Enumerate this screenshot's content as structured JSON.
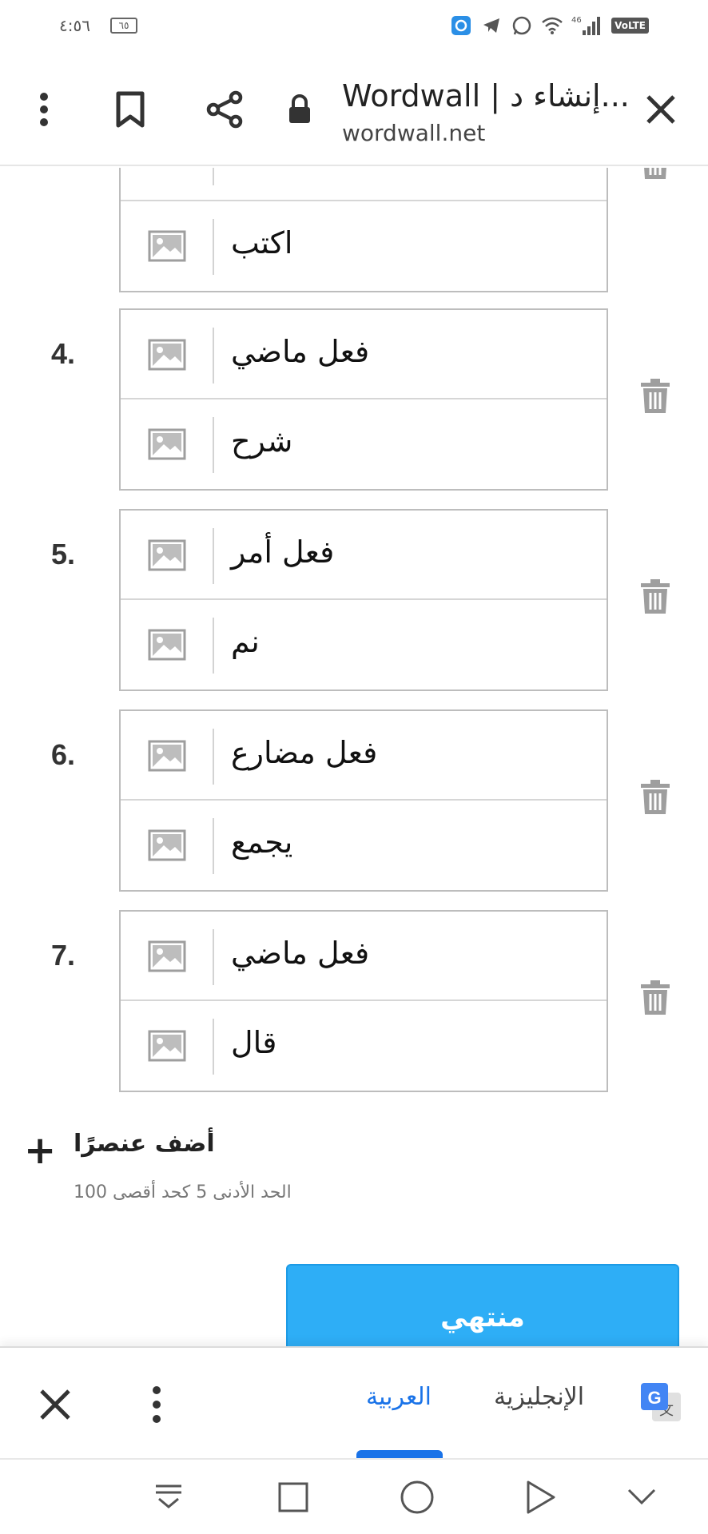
{
  "status_bar": {
    "time": "٤:٥٦",
    "battery": "٦٥",
    "network_label": "46",
    "volte_label": "VoLTE"
  },
  "browser": {
    "title": "Wordwall | إنشاء د...",
    "url": "wordwall.net"
  },
  "partial_item": {
    "row_text": "اكتب"
  },
  "items": [
    {
      "number": "4.",
      "term": "فعل ماضي",
      "definition": "شرح"
    },
    {
      "number": "5.",
      "term": "فعل أمر",
      "definition": "نم"
    },
    {
      "number": "6.",
      "term": "فعل مضارع",
      "definition": "يجمع"
    },
    {
      "number": "7.",
      "term": "فعل ماضي",
      "definition": "قال"
    }
  ],
  "add_item": {
    "label": "أضف عنصرًا",
    "limit_note": "الحد الأدنى 5 كحد أقصى 100"
  },
  "done_button": {
    "label": "منتهي"
  },
  "translate_bar": {
    "lang_english": "الإنجليزية",
    "lang_arabic": "العربية",
    "active_lang": "العربية"
  },
  "colors": {
    "accent_blue": "#2eaef6",
    "translate_active": "#1a73e8"
  }
}
